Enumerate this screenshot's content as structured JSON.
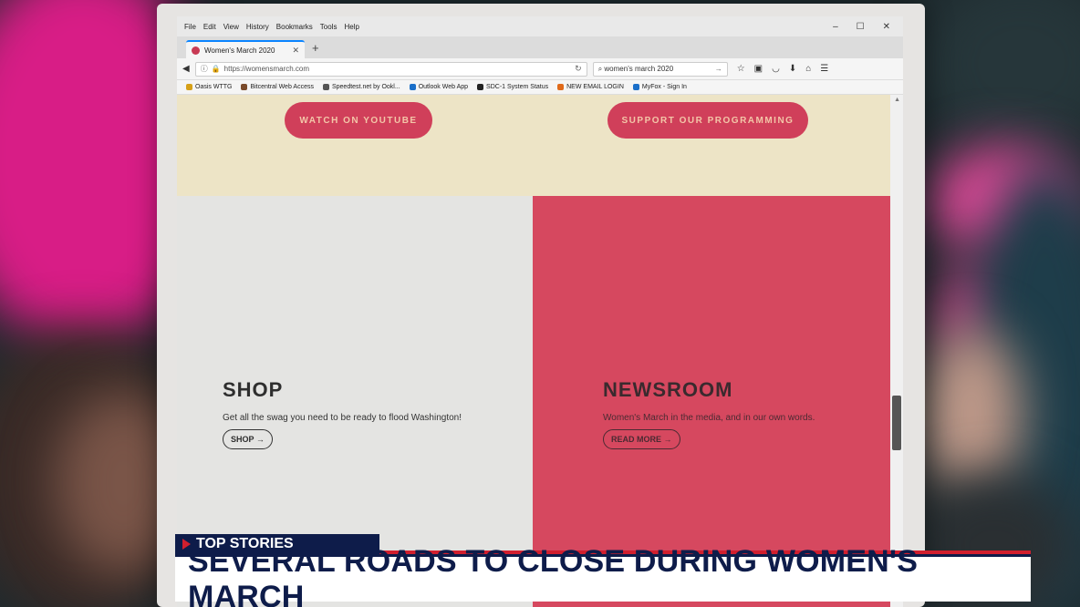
{
  "browser": {
    "menu": [
      "File",
      "Edit",
      "View",
      "History",
      "Bookmarks",
      "Tools",
      "Help"
    ],
    "window_controls": [
      "–",
      "☐",
      "✕"
    ],
    "tab": {
      "title": "Women's March 2020",
      "close": "✕"
    },
    "new_tab": "+",
    "url": "https://womensmarch.com",
    "search_value": "women's march 2020",
    "bookmarks": [
      {
        "label": "Oasis WTTG",
        "color": "#d6a018"
      },
      {
        "label": "Bitcentral Web Access",
        "color": "#7a4a2a"
      },
      {
        "label": "Speedtest.net by Ookl...",
        "color": "#555555"
      },
      {
        "label": "Outlook Web App",
        "color": "#1a6fc9"
      },
      {
        "label": "SDC-1 System Status",
        "color": "#222222"
      },
      {
        "label": "NEW EMAIL LOGIN",
        "color": "#e06a1a"
      },
      {
        "label": "MyFox - Sign In",
        "color": "#1a6fc9"
      }
    ]
  },
  "page": {
    "hero_buttons": [
      "WATCH ON YOUTUBE",
      "SUPPORT OUR PROGRAMMING"
    ],
    "shop": {
      "title": "SHOP",
      "desc": "Get all the swag you need to be ready to flood Washington!",
      "button": "SHOP →"
    },
    "newsroom": {
      "title": "NEWSROOM",
      "desc": "Women's March in the media, and in our own words.",
      "button": "READ MORE →"
    }
  },
  "lower_third": {
    "tag": "TOP STORIES",
    "headline": "SEVERAL ROADS TO CLOSE DURING WOMEN'S MARCH"
  }
}
